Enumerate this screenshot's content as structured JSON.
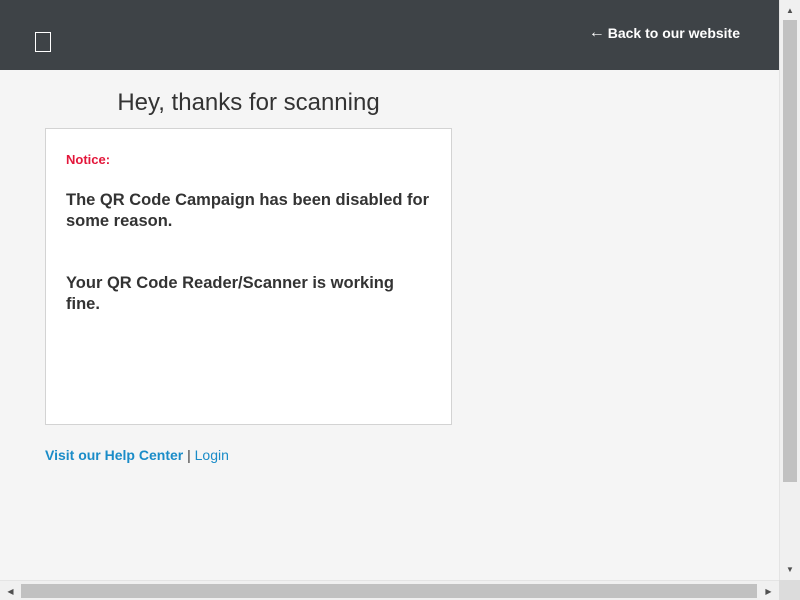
{
  "header": {
    "back_arrow": "←",
    "back_label": "Back to our website",
    "logo_icon": "square-outline-icon"
  },
  "main": {
    "title": "Hey, thanks for scanning",
    "notice": {
      "label": "Notice:",
      "messages": [
        "The QR Code Campaign has been disabled for some reason.",
        "Your QR Code Reader/Scanner is working fine."
      ]
    },
    "footer": {
      "help_label": "Visit our Help Center",
      "separator": "|",
      "login_label": "Login"
    }
  },
  "scrollbars": {
    "up_icon": "▲",
    "down_icon": "▼",
    "left_icon": "◀",
    "right_icon": "▶"
  },
  "colors": {
    "header_bg": "#3e4347",
    "page_bg": "#f5f5f5",
    "notice_red": "#e3173b",
    "link_blue": "#1a8cc8"
  }
}
